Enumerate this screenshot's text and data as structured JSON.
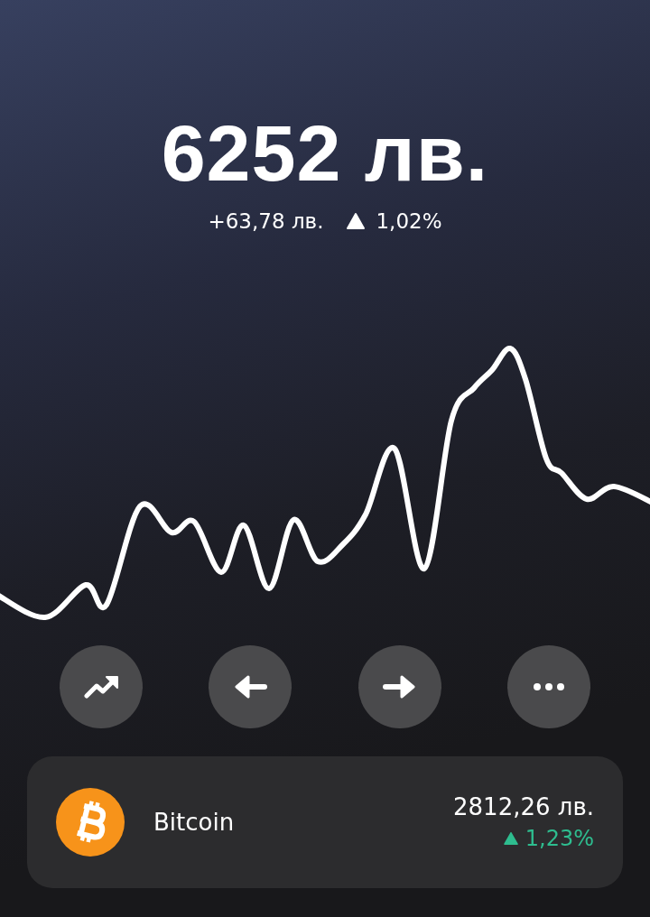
{
  "balance": {
    "amount": "6252 лв.",
    "change": "+63,78 лв.",
    "percent": "1,02%",
    "up": true
  },
  "actions": [
    {
      "kind": "trend"
    },
    {
      "kind": "send"
    },
    {
      "kind": "receive"
    },
    {
      "kind": "more"
    }
  ],
  "assets": [
    {
      "name": "Bitcoin",
      "value": "2812,26 лв.",
      "percent": "1,23%",
      "up": true,
      "color": "#f7931a"
    }
  ]
}
